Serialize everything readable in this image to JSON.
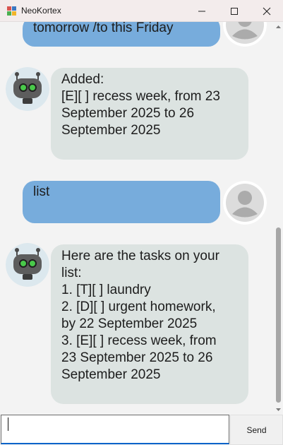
{
  "window": {
    "title": "NeoKortex",
    "icon": "app-cube-icon"
  },
  "chat": {
    "messages": [
      {
        "sender": "user",
        "lines": [
          "tomorrow /to this Friday"
        ]
      },
      {
        "sender": "bot",
        "lines": [
          "Added:",
          "[E][ ] recess week, from 23",
          "September 2025 to 26",
          "September 2025"
        ]
      },
      {
        "sender": "user",
        "lines": [
          "list"
        ]
      },
      {
        "sender": "bot",
        "lines": [
          "Here are the tasks on your",
          "list:",
          "1. [T][ ] laundry",
          "2. [D][ ] urgent homework,",
          "by 22 September 2025",
          "3. [E][ ] recess week, from",
          "23 September 2025 to 26",
          "September 2025"
        ]
      }
    ]
  },
  "input": {
    "value": "",
    "placeholder": ""
  },
  "send": {
    "label": "Send"
  },
  "colors": {
    "user_bubble": "#77acdc",
    "bot_bubble": "#dce3e1",
    "input_focus": "#0a63c9"
  }
}
